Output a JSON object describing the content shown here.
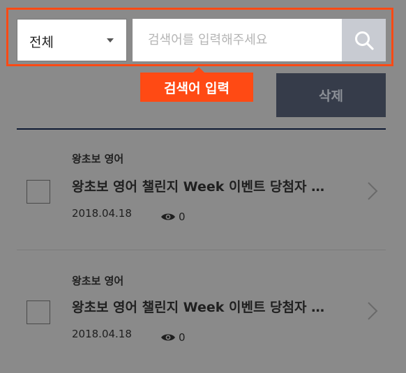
{
  "search": {
    "dropdown_selected": "전체",
    "placeholder": "검색어를 입력해주세요",
    "value": ""
  },
  "tooltip": {
    "label": "검색어 입력"
  },
  "toolbar": {
    "delete_label": "삭제"
  },
  "items": [
    {
      "category": "왕초보 영어",
      "title": "왕초보 영어 챌린지 Week 이벤트 당첨자 …",
      "date": "2018.04.18",
      "views": "0"
    },
    {
      "category": "왕초보 영어",
      "title": "왕초보 영어 챌린지 Week 이벤트 당첨자 …",
      "date": "2018.04.18",
      "views": "0"
    }
  ],
  "colors": {
    "highlight": "#ff4a14",
    "overlay_gray": "#8a8a8a",
    "delete_button_bg": "#363c4a",
    "search_button_bg": "#c8cbd2"
  },
  "icons": {
    "search": "search-icon",
    "views": "eye-icon",
    "open": "chevron-right-icon",
    "dropdown": "chevron-down-icon"
  }
}
